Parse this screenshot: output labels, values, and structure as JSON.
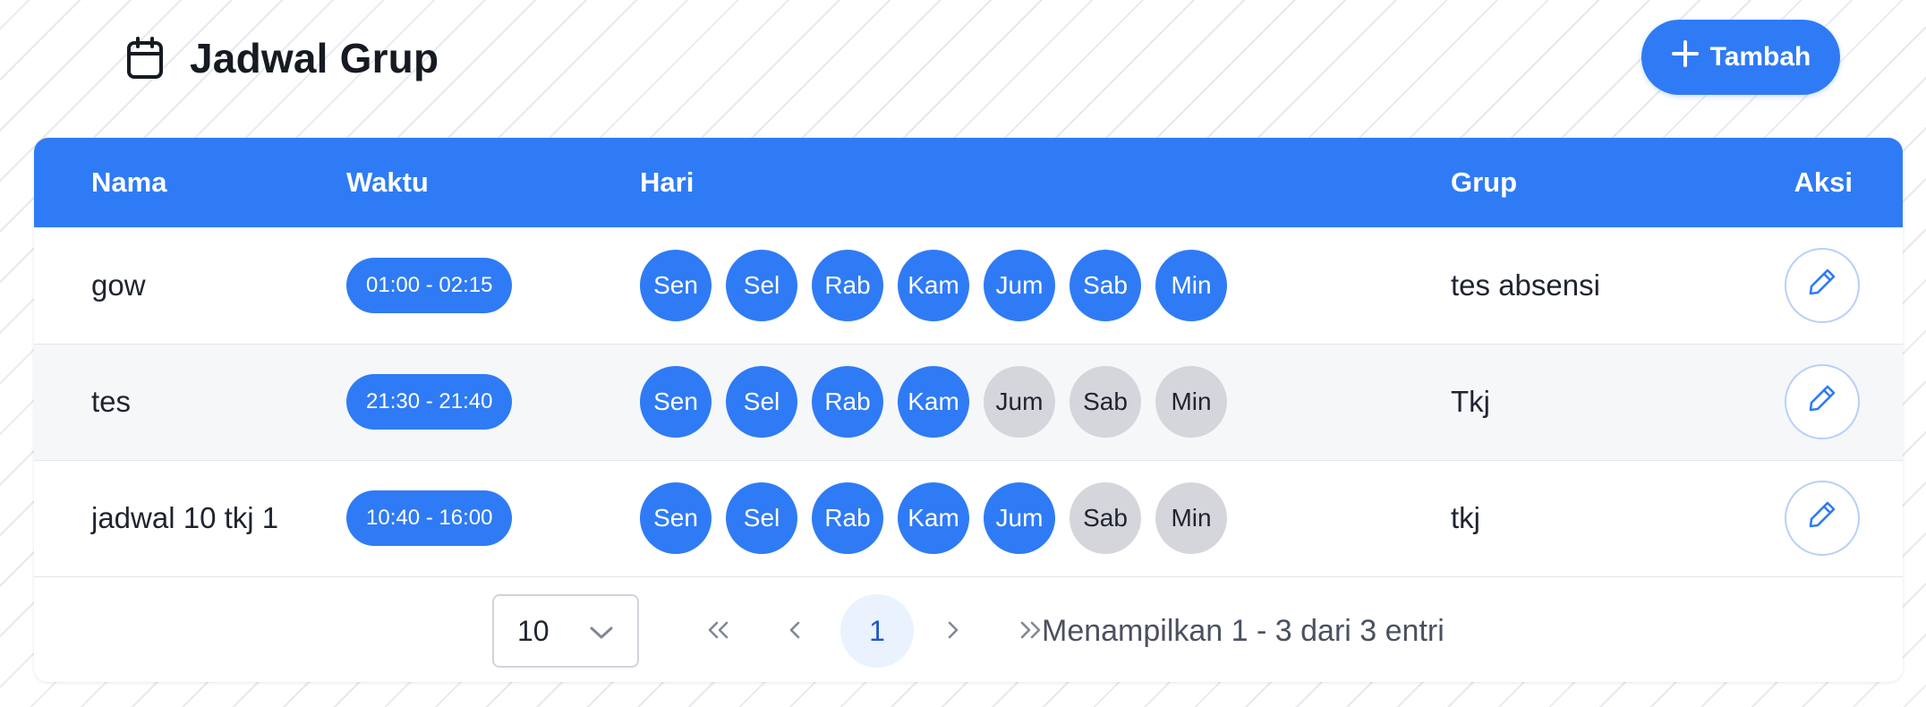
{
  "page": {
    "title": "Jadwal Grup",
    "add_button_label": "Tambah"
  },
  "table": {
    "headers": {
      "nama": "Nama",
      "waktu": "Waktu",
      "hari": "Hari",
      "grup": "Grup",
      "aksi": "Aksi"
    },
    "day_labels": [
      "Sen",
      "Sel",
      "Rab",
      "Kam",
      "Jum",
      "Sab",
      "Min"
    ],
    "rows": [
      {
        "nama": "gow",
        "waktu": "01:00 - 02:15",
        "days_active": [
          true,
          true,
          true,
          true,
          true,
          true,
          true
        ],
        "grup": "tes absensi"
      },
      {
        "nama": "tes",
        "waktu": "21:30 - 21:40",
        "days_active": [
          true,
          true,
          true,
          true,
          false,
          false,
          false
        ],
        "grup": "Tkj"
      },
      {
        "nama": "jadwal 10 tkj 1",
        "waktu": "10:40 - 16:00",
        "days_active": [
          true,
          true,
          true,
          true,
          true,
          false,
          false
        ],
        "grup": "tkj"
      }
    ]
  },
  "pagination": {
    "per_page": "10",
    "first_icon": "double-chevron-left-icon",
    "prev_icon": "chevron-left-icon",
    "current_page": "1",
    "next_icon": "chevron-right-icon",
    "last_icon": "double-chevron-right-icon",
    "summary": "Menampilkan 1 - 3 dari 3 entri"
  },
  "colors": {
    "primary": "#2f7bf5",
    "day_inactive": "#d4d6dc"
  }
}
